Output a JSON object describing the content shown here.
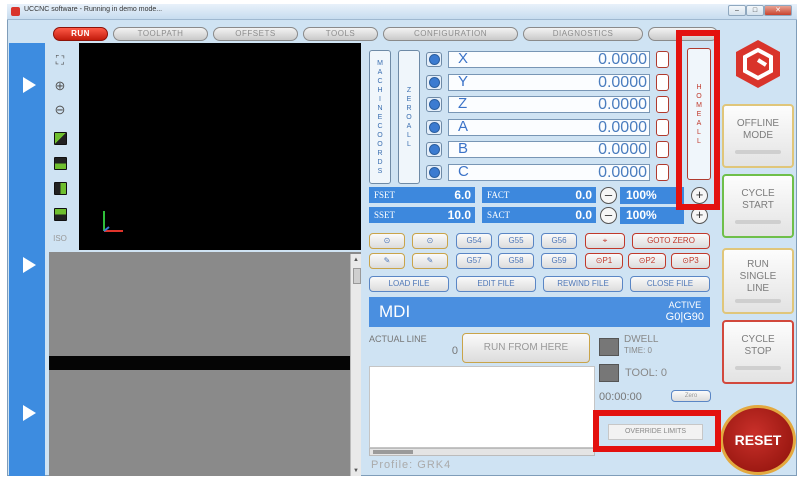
{
  "window": {
    "title": "UCCNC software - Running in demo mode...",
    "controls": [
      "–",
      "□",
      "✕"
    ]
  },
  "tabs": [
    "RUN",
    "TOOLPATH",
    "OFFSETS",
    "TOOLS",
    "CONFIGURATION",
    "DIAGNOSTICS",
    ""
  ],
  "toolbar": {
    "icons": [
      "fit-icon",
      "zoom-in-icon",
      "zoom-out-icon",
      "view-iso-icon",
      "view-top-icon",
      "view-front-icon",
      "view-side-icon",
      "view-right-icon"
    ],
    "iso_label": "ISO"
  },
  "axes": [
    {
      "name": "X",
      "value": "0.0000"
    },
    {
      "name": "Y",
      "value": "0.0000"
    },
    {
      "name": "Z",
      "value": "0.0000"
    },
    {
      "name": "A",
      "value": "0.0000"
    },
    {
      "name": "B",
      "value": "0.0000"
    },
    {
      "name": "C",
      "value": "0.0000"
    }
  ],
  "vertical_buttons": {
    "machine_coords": [
      "M",
      "A",
      "C",
      "H",
      "I",
      "N",
      "E",
      "",
      "C",
      "O",
      "O",
      "R",
      "D",
      "S"
    ],
    "zero_all": [
      "Z",
      "E",
      "R",
      "O",
      "",
      "A",
      "L",
      "L"
    ],
    "home_all": [
      "H",
      "O",
      "M",
      "E",
      "",
      "A",
      "L",
      "L"
    ]
  },
  "feed": {
    "fset_label": "FSET",
    "fset_value": "6.0",
    "fact_label": "FACT",
    "fact_value": "0.0",
    "feed_override": "100%",
    "sset_label": "SSET",
    "sset_value": "10.0",
    "sact_label": "SACT",
    "sact_value": "0.0",
    "spindle_override": "100%",
    "minus": "–",
    "plus": "+"
  },
  "code_buttons": {
    "row1": [
      "G54",
      "G55",
      "G56",
      "GOTO ZERO"
    ],
    "row2": [
      "G57",
      "G58",
      "G59",
      "⊙P1",
      "⊙P2",
      "⊙P3"
    ],
    "row3": [
      "LOAD FILE",
      "EDIT FILE",
      "REWIND FILE",
      "CLOSE FILE"
    ]
  },
  "mdi": {
    "label": "MDI",
    "active_label": "ACTIVE",
    "active_value": "G0|G90"
  },
  "status": {
    "actual_line_label": "ACTUAL LINE",
    "actual_line_value": "0",
    "run_from_here": "RUN FROM HERE",
    "dwell_label": "DWELL",
    "dwell_time": "TIME: 0",
    "tool_label": "TOOL: 0",
    "timer": "00:00:00",
    "timer_btn": "Zero",
    "override_limits": "OVERRIDE LIMITS",
    "profile": "Profile: GRK4"
  },
  "right_buttons": {
    "offline_mode": [
      "OFFLINE",
      "MODE"
    ],
    "cycle_start": [
      "CYCLE",
      "START"
    ],
    "run_single_line": [
      "RUN",
      "SINGLE",
      "LINE"
    ],
    "cycle_stop": [
      "CYCLE",
      "STOP"
    ],
    "reset": "RESET"
  },
  "colors": {
    "accent_blue": "#3d88dd",
    "run_red": "#d9342b",
    "highlight_red": "#e3110f",
    "reset_red": "#b0170f"
  }
}
